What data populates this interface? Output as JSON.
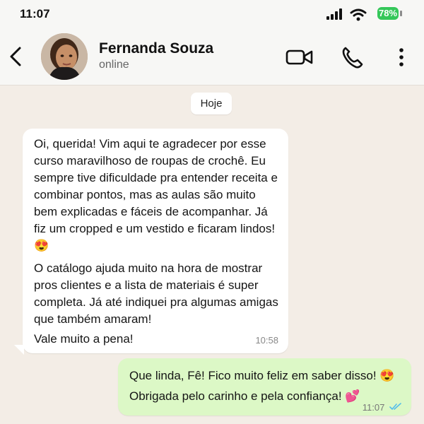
{
  "status_bar": {
    "time": "11:07",
    "battery": "78%"
  },
  "chat": {
    "contact_name": "Fernanda Souza",
    "contact_status": "online",
    "date_chip": "Hoje",
    "incoming": {
      "p1": "Oi, querida! Vim aqui te agradecer por esse curso maravilhoso de roupas de crochê. Eu sempre tive dificuldade pra entender receita e combinar pontos, mas as aulas são muito bem explicadas e fáceis de acompanhar. Já fiz um cropped e um vestido e ficaram lindos! 😍",
      "p2": "O catálogo ajuda muito na hora de mostrar pros clientes e a lista de materiais é super completa. Já até indiquei pra algumas amigas que também amaram!",
      "p3": "Vale muito a pena!",
      "time": "10:58"
    },
    "outgoing": {
      "line1": "Que linda, Fê! Fico muito feliz em saber disso! 😍",
      "line2": "Obrigada pelo carinho e pela confiança! 💕",
      "time": "11:07"
    }
  },
  "icons": {
    "back": "chevron-left-icon",
    "video": "video-camera-icon",
    "phone": "phone-icon",
    "menu": "more-vertical-icon",
    "read_receipt": "double-check-icon"
  },
  "colors": {
    "chat_background": "#f3ede6",
    "incoming_bubble": "#ffffff",
    "outgoing_bubble": "#dcf8c6",
    "battery": "#34c759",
    "read_ticks": "#53bdeb"
  }
}
